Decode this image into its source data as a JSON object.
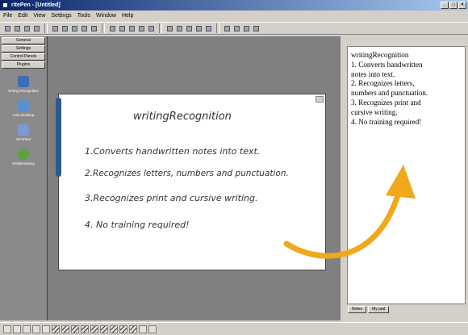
{
  "window": {
    "title": "ritePen - [Untitled]"
  },
  "menu": [
    "File",
    "Edit",
    "View",
    "Settings",
    "Tools",
    "Window",
    "Help"
  ],
  "sidebar": {
    "tabs": [
      "General",
      "Settings",
      "Control Panels",
      "Plugins"
    ],
    "plugins": [
      {
        "label": "writing Recognition",
        "icon": "pen-tablet-icon",
        "color": "#3b6fb5"
      },
      {
        "label": "Auto Desktop",
        "icon": "desktop-icon",
        "color": "#5a8fd0"
      },
      {
        "label": "InkToText",
        "icon": "ink-icon",
        "color": "#7a9ad0"
      },
      {
        "label": "WebBrowsing",
        "icon": "globe-icon",
        "color": "#5fa044"
      }
    ]
  },
  "handwriting": {
    "title": "writingRecognition",
    "lines": [
      "1.Converts handwritten notes into text.",
      "2.Recognizes letters, numbers and punctuation.",
      "3.Recognizes print and cursive writing.",
      "4. No training required!"
    ]
  },
  "recognized_text": {
    "lines": [
      "writingRecognition",
      "1. Converts handwritten",
      "notes into text.",
      "2. Recognizes letters,",
      "numbers and punctuation.",
      "3. Recognizes print and",
      "cursive writing.",
      "4. No training required!"
    ]
  },
  "right_tabs": [
    "Notes",
    "My pad"
  ],
  "colors": {
    "arrow": "#f0a81c",
    "note_tab": "#2a5b8c",
    "titlebar": "#0a246a"
  }
}
